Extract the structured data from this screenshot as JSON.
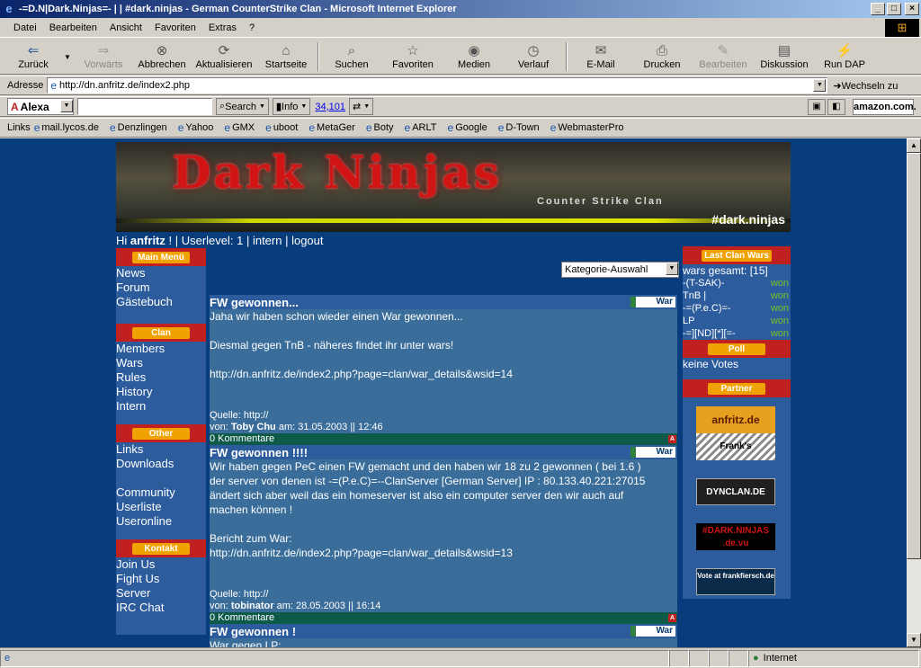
{
  "window": {
    "title": "-=D.N|Dark.Ninjas=- | | #dark.ninjas - German CounterStrike Clan - Microsoft Internet Explorer",
    "min": "_",
    "max": "□",
    "close": "×"
  },
  "menu": [
    "Datei",
    "Bearbeiten",
    "Ansicht",
    "Favoriten",
    "Extras",
    "?"
  ],
  "toolbar": {
    "back": "Zurück",
    "forward": "Vorwärts",
    "stop": "Abbrechen",
    "refresh": "Aktualisieren",
    "home": "Startseite",
    "search": "Suchen",
    "favorites": "Favoriten",
    "media": "Medien",
    "history": "Verlauf",
    "mail": "E-Mail",
    "print": "Drucken",
    "edit": "Bearbeiten",
    "discuss": "Diskussion",
    "rundap": "Run DAP"
  },
  "address": {
    "label": "Adresse",
    "url": "http://dn.anfritz.de/index2.php",
    "go": "Wechseln zu"
  },
  "alexa": {
    "brand": "Alexa",
    "search": "Search",
    "info": "Info",
    "count": "34,101",
    "amazon": "amazon.com."
  },
  "links": {
    "label": "Links",
    "items": [
      "mail.lycos.de",
      "Denzlingen",
      "Yahoo",
      "GMX",
      "uboot",
      "MetaGer",
      "Boty",
      "ARLT",
      "Google",
      "D-Town",
      "WebmasterPro"
    ]
  },
  "status": {
    "zone": "Internet"
  },
  "banner": {
    "logo": "Dark Ninjas",
    "sub": "Counter Strike Clan",
    "tag": "#dark.ninjas"
  },
  "greeting": {
    "hi": "Hi ",
    "user": "anfritz",
    "rest": " ! | Userlevel: 1 | intern | logout"
  },
  "nav": {
    "main": {
      "head": "Main Menü",
      "items": [
        "News",
        "Forum",
        "Gästebuch"
      ]
    },
    "clan": {
      "head": "Clan",
      "items": [
        "Members",
        "Wars",
        "Rules",
        "History",
        "Intern"
      ]
    },
    "other": {
      "head": "Other",
      "items": [
        "Links",
        "Downloads",
        "",
        "Community",
        "Userliste",
        "Useronline"
      ]
    },
    "contact": {
      "head": "Kontakt",
      "items": [
        "Join Us",
        "Fight Us",
        "Server",
        "IRC Chat"
      ]
    }
  },
  "category_select": "Kategorie-Auswahl",
  "news": [
    {
      "title": "FW gewonnen...",
      "badge": "War",
      "body": "Jaha wir haben schon wieder einen War gewonnen...\n\nDiesmal gegen TnB - näheres findet ihr unter wars!\n\nhttp://dn.anfritz.de/index2.php?page=clan/war_details&wsid=14",
      "source": "Quelle: http://",
      "by": "von: ",
      "author": "Toby Chu",
      "date": " am: 31.05.2003 || 12:46",
      "comments": "0 Kommentare"
    },
    {
      "title": "FW gewonnen !!!!",
      "badge": "War",
      "body": "Wir haben gegen PeC einen FW gemacht und den haben wir 18 zu 2 gewonnen ( bei 1.6 )\nder server von denen ist -=(P.e.C)=--ClanServer [German Server] IP : 80.133.40.221:27015\nändert sich aber weil das ein homeserver ist also ein computer server den wir auch auf\nmachen können !\n\nBericht zum War:\nhttp://dn.anfritz.de/index2.php?page=clan/war_details&wsid=13",
      "source": "Quelle: http://",
      "by": "von: ",
      "author": "tobinator",
      "date": " am: 28.05.2003 || 16:14",
      "comments": "0 Kommentare"
    },
    {
      "title": "FW gewonnen !",
      "badge": "War",
      "body": "War gegen LP:"
    }
  ],
  "wars": {
    "head": "Last Clan Wars",
    "total": "wars gesamt: [15]",
    "rows": [
      {
        "name": "-(T-SAK)-",
        "res": "won"
      },
      {
        "name": "TnB |",
        "res": "won"
      },
      {
        "name": "-=(P.e.C)=-",
        "res": "won"
      },
      {
        "name": "LP",
        "res": "won"
      },
      {
        "name": "-=][ND][*][=-",
        "res": "won"
      }
    ]
  },
  "poll": {
    "head": "Poll",
    "text": "keine Votes"
  },
  "partner": {
    "head": "Partner",
    "items": [
      "anfritz.de",
      "Frank's",
      "DYNCLAN.DE",
      "#DARK.NINJAS .de.vu",
      "Vote at frankfiersch.de"
    ]
  }
}
